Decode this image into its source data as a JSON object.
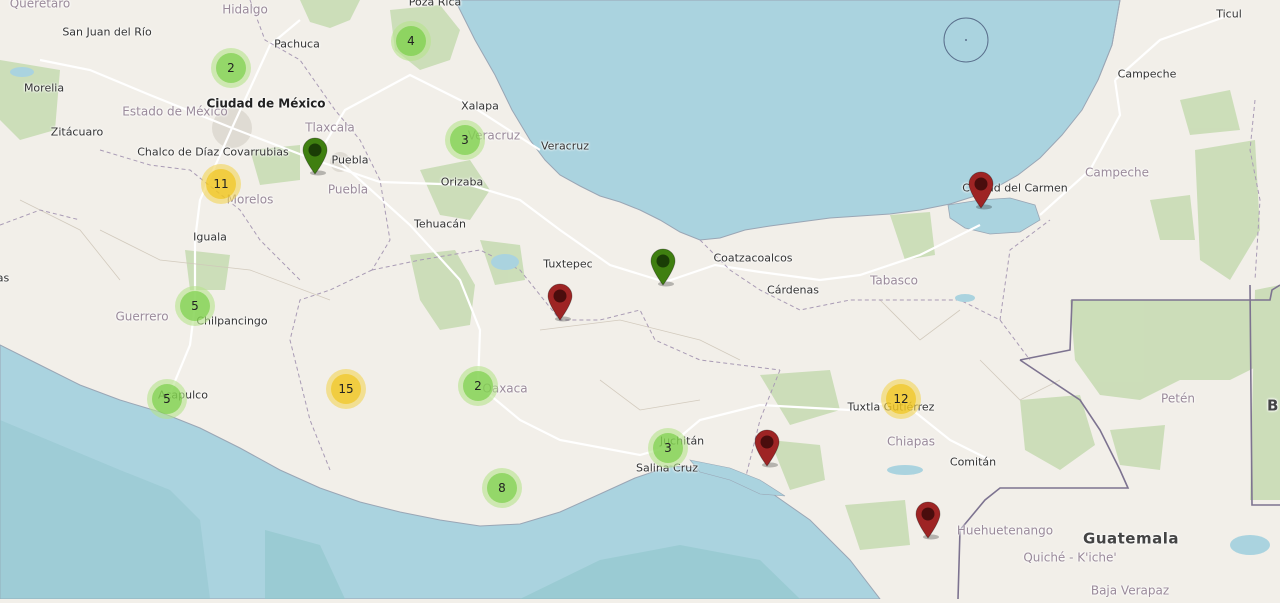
{
  "map": {
    "colors": {
      "land": "#f2efe9",
      "water": "#aad3df",
      "water_dark": "#8cc4c8",
      "park": "#c8dcb4",
      "road": "#ffffff",
      "border": "#7d7390"
    },
    "places": [
      {
        "id": "queretaro",
        "text": "Querétaro",
        "cls": "state"
      },
      {
        "id": "hidalgo",
        "text": "Hidalgo",
        "cls": "state"
      },
      {
        "id": "poza-rica",
        "text": "Poza Rica",
        "cls": ""
      },
      {
        "id": "san-juan-del-rio",
        "text": "San Juan del Río",
        "cls": ""
      },
      {
        "id": "pachuca",
        "text": "Pachuca",
        "cls": ""
      },
      {
        "id": "morelia",
        "text": "Morelia",
        "cls": ""
      },
      {
        "id": "estado-de-mexico",
        "text": "Estado de México",
        "cls": "state"
      },
      {
        "id": "ciudad-de-mexico",
        "text": "Ciudad de México",
        "cls": "city"
      },
      {
        "id": "zitacuaro",
        "text": "Zitácuaro",
        "cls": ""
      },
      {
        "id": "tlaxcala",
        "text": "Tlaxcala",
        "cls": "state"
      },
      {
        "id": "xalapa",
        "text": "Xalapa",
        "cls": ""
      },
      {
        "id": "veracruz-state",
        "text": "Veracruz",
        "cls": "state"
      },
      {
        "id": "chalco",
        "text": "Chalco de Díaz Covarrubias",
        "cls": ""
      },
      {
        "id": "puebla-city",
        "text": "Puebla",
        "cls": ""
      },
      {
        "id": "puebla-state",
        "text": "Puebla",
        "cls": "state"
      },
      {
        "id": "veracruz-city",
        "text": "Veracruz",
        "cls": ""
      },
      {
        "id": "orizaba",
        "text": "Orizaba",
        "cls": ""
      },
      {
        "id": "morelos",
        "text": "Morelos",
        "cls": "state"
      },
      {
        "id": "iguala",
        "text": "Iguala",
        "cls": ""
      },
      {
        "id": "tehuacan",
        "text": "Tehuacán",
        "cls": ""
      },
      {
        "id": "tuxtepec",
        "text": "Tuxtepec",
        "cls": ""
      },
      {
        "id": "coatzacoalcos",
        "text": "Coatzacoalcos",
        "cls": ""
      },
      {
        "id": "cardenas",
        "text": "Cárdenas",
        "cls": ""
      },
      {
        "id": "tabasco",
        "text": "Tabasco",
        "cls": "state"
      },
      {
        "id": "ciudad-del-carmen",
        "text": "Ciudad del Carmen",
        "cls": ""
      },
      {
        "id": "campeche-city",
        "text": "Campeche",
        "cls": ""
      },
      {
        "id": "campeche-state",
        "text": "Campeche",
        "cls": "state"
      },
      {
        "id": "ticul",
        "text": "Ticul",
        "cls": ""
      },
      {
        "id": "guerrero",
        "text": "Guerrero",
        "cls": "state"
      },
      {
        "id": "chilpancingo",
        "text": "Chilpancingo",
        "cls": ""
      },
      {
        "id": "acapulco",
        "text": "Acapulco",
        "cls": ""
      },
      {
        "id": "oaxaca",
        "text": "Oaxaca",
        "cls": "state"
      },
      {
        "id": "juchitan",
        "text": "Juchitán",
        "cls": ""
      },
      {
        "id": "salina-cruz",
        "text": "Salina Cruz",
        "cls": ""
      },
      {
        "id": "tuxtla",
        "text": "Tuxtla Gutiérrez",
        "cls": ""
      },
      {
        "id": "chiapas",
        "text": "Chiapas",
        "cls": "state"
      },
      {
        "id": "comitan",
        "text": "Comitán",
        "cls": ""
      },
      {
        "id": "peten",
        "text": "Petén",
        "cls": "state"
      },
      {
        "id": "huehuetenango",
        "text": "Huehuetenango",
        "cls": "state"
      },
      {
        "id": "guatemala",
        "text": "Guatemala",
        "cls": "country"
      },
      {
        "id": "quiche",
        "text": "Quiché - K'iche'",
        "cls": "state"
      },
      {
        "id": "baja-verapaz",
        "text": "Baja Verapaz",
        "cls": "state"
      },
      {
        "id": "edge-b",
        "text": "B",
        "cls": "country"
      },
      {
        "id": "edge-as",
        "text": "as",
        "cls": ""
      }
    ],
    "clusters": [
      {
        "count": "2",
        "size": "small"
      },
      {
        "count": "4",
        "size": "small"
      },
      {
        "count": "3",
        "size": "small"
      },
      {
        "count": "11",
        "size": "medium"
      },
      {
        "count": "5",
        "size": "small"
      },
      {
        "count": "5",
        "size": "small"
      },
      {
        "count": "15",
        "size": "medium"
      },
      {
        "count": "2",
        "size": "small"
      },
      {
        "count": "3",
        "size": "small"
      },
      {
        "count": "8",
        "size": "small"
      },
      {
        "count": "12",
        "size": "medium"
      }
    ],
    "markers": [
      {
        "color": "green",
        "fill": "#3f7f10",
        "dot": "#1a3d06"
      },
      {
        "color": "green",
        "fill": "#3f7f10",
        "dot": "#1a3d06"
      },
      {
        "color": "red",
        "fill": "#9e2424",
        "dot": "#4a0d0d"
      },
      {
        "color": "red",
        "fill": "#9e2424",
        "dot": "#4a0d0d"
      },
      {
        "color": "red",
        "fill": "#9e2424",
        "dot": "#4a0d0d"
      },
      {
        "color": "red",
        "fill": "#9e2424",
        "dot": "#4a0d0d"
      }
    ]
  }
}
